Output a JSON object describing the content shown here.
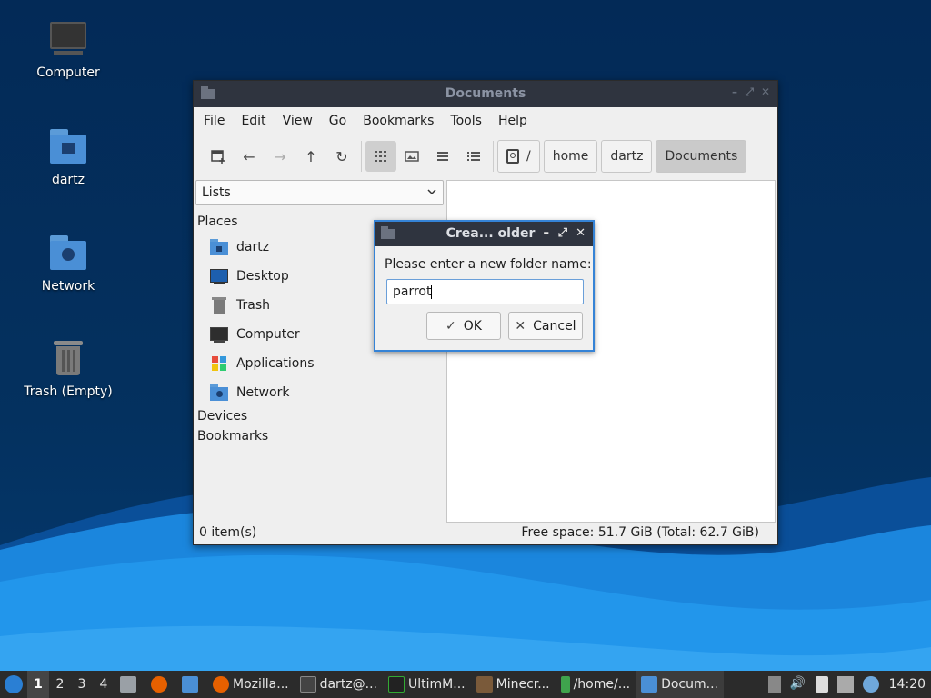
{
  "desktop": {
    "icons": [
      {
        "label": "Computer"
      },
      {
        "label": "dartz"
      },
      {
        "label": "Network"
      },
      {
        "label": "Trash (Empty)"
      }
    ]
  },
  "window": {
    "title": "Documents",
    "menu": [
      "File",
      "Edit",
      "View",
      "Go",
      "Bookmarks",
      "Tools",
      "Help"
    ],
    "breadcrumbs": [
      "/",
      "home",
      "dartz",
      "Documents"
    ],
    "side_selector": "Lists",
    "places_header": "Places",
    "places": [
      "dartz",
      "Desktop",
      "Trash",
      "Computer",
      "Applications",
      "Network"
    ],
    "devices_header": "Devices",
    "bookmarks_header": "Bookmarks",
    "status_items": "0 item(s)",
    "status_free": "Free space: 51.7 GiB (Total: 62.7 GiB)"
  },
  "dialog": {
    "title": "Crea... older",
    "prompt": "Please enter a new folder name:",
    "input_value": "parrot",
    "ok_label": "OK",
    "cancel_label": "Cancel"
  },
  "taskbar": {
    "workspaces": [
      "1",
      "2",
      "3",
      "4"
    ],
    "active_workspace": "1",
    "tasks": [
      "Mozilla...",
      "dartz@...",
      "UltimM...",
      "Minecr...",
      "/home/...",
      "Docum..."
    ],
    "clock": "14:20"
  },
  "colors": {
    "desktop_bg": "#03305d",
    "wave_light": "#1e8fe0",
    "titlebar": "#2f343f",
    "accent": "#3583d6"
  }
}
